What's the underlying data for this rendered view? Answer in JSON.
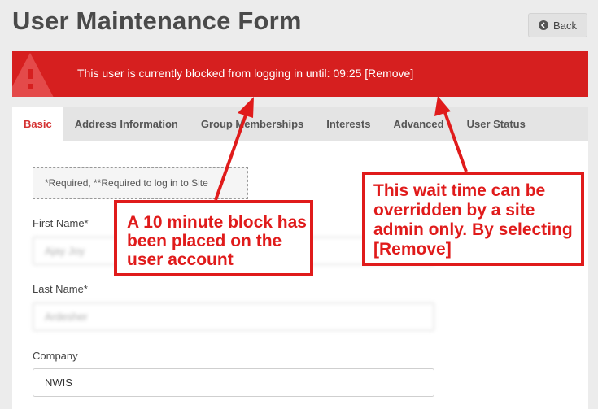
{
  "page": {
    "title": "User Maintenance Form"
  },
  "header": {
    "back_label": "Back"
  },
  "alert": {
    "message": "This user is currently blocked from logging in until:",
    "time": "09:25",
    "remove_label": "[Remove]"
  },
  "tabs": [
    {
      "label": "Basic",
      "active": true
    },
    {
      "label": "Address Information"
    },
    {
      "label": "Group Memberships"
    },
    {
      "label": "Interests"
    },
    {
      "label": "Advanced"
    },
    {
      "label": "User Status"
    }
  ],
  "form": {
    "required_note": "*Required, **Required to log in to Site",
    "first_name": {
      "label": "First Name*",
      "value": "Ajay Joy"
    },
    "last_name": {
      "label": "Last Name*",
      "value": "Ardesher"
    },
    "company": {
      "label": "Company",
      "value": "NWIS"
    }
  },
  "callouts": {
    "block_note": "A 10 minute block has been placed on the user account",
    "override_note": "This wait time can be overridden by a site admin only. By selecting [Remove]"
  },
  "colors": {
    "alert_bg": "#d61f1f",
    "active_tab": "#d43030",
    "callout": "#e01b1b"
  },
  "icons": {
    "back": "circle-arrow-left-icon",
    "warning": "warning-triangle-icon"
  }
}
